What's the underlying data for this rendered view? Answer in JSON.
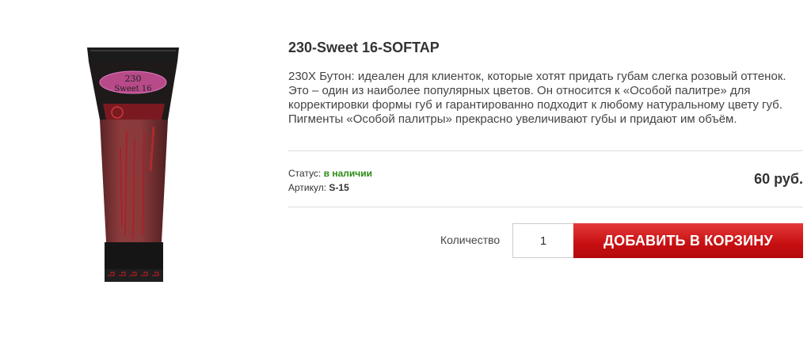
{
  "product": {
    "title": "230-Sweet 16-SOFTAP",
    "description": "230Х Бутон: идеален для клиенток, которые хотят придать губам слегка розовый оттенок. Это – один из наиболее популярных цветов. Он относится к «Особой палитре» для корректировки формы губ и гарантированно подходит к любому натуральному цвету губ. Пигменты «Особой палитры» прекрасно увеличивают губы и придают им объём.",
    "image_label_line1": "230",
    "image_label_line2": "Sweet 16"
  },
  "meta": {
    "status_label": "Статус:",
    "status_value": "в наличии",
    "sku_label": "Артикул:",
    "sku_value": "S-15"
  },
  "price": "60 руб.",
  "cart": {
    "quantity_label": "Количество",
    "quantity_value": "1",
    "add_button_label": "ДОБАВИТЬ В КОРЗИНУ"
  },
  "colors": {
    "accent": "#c70f11",
    "status": "#2a8a12"
  }
}
